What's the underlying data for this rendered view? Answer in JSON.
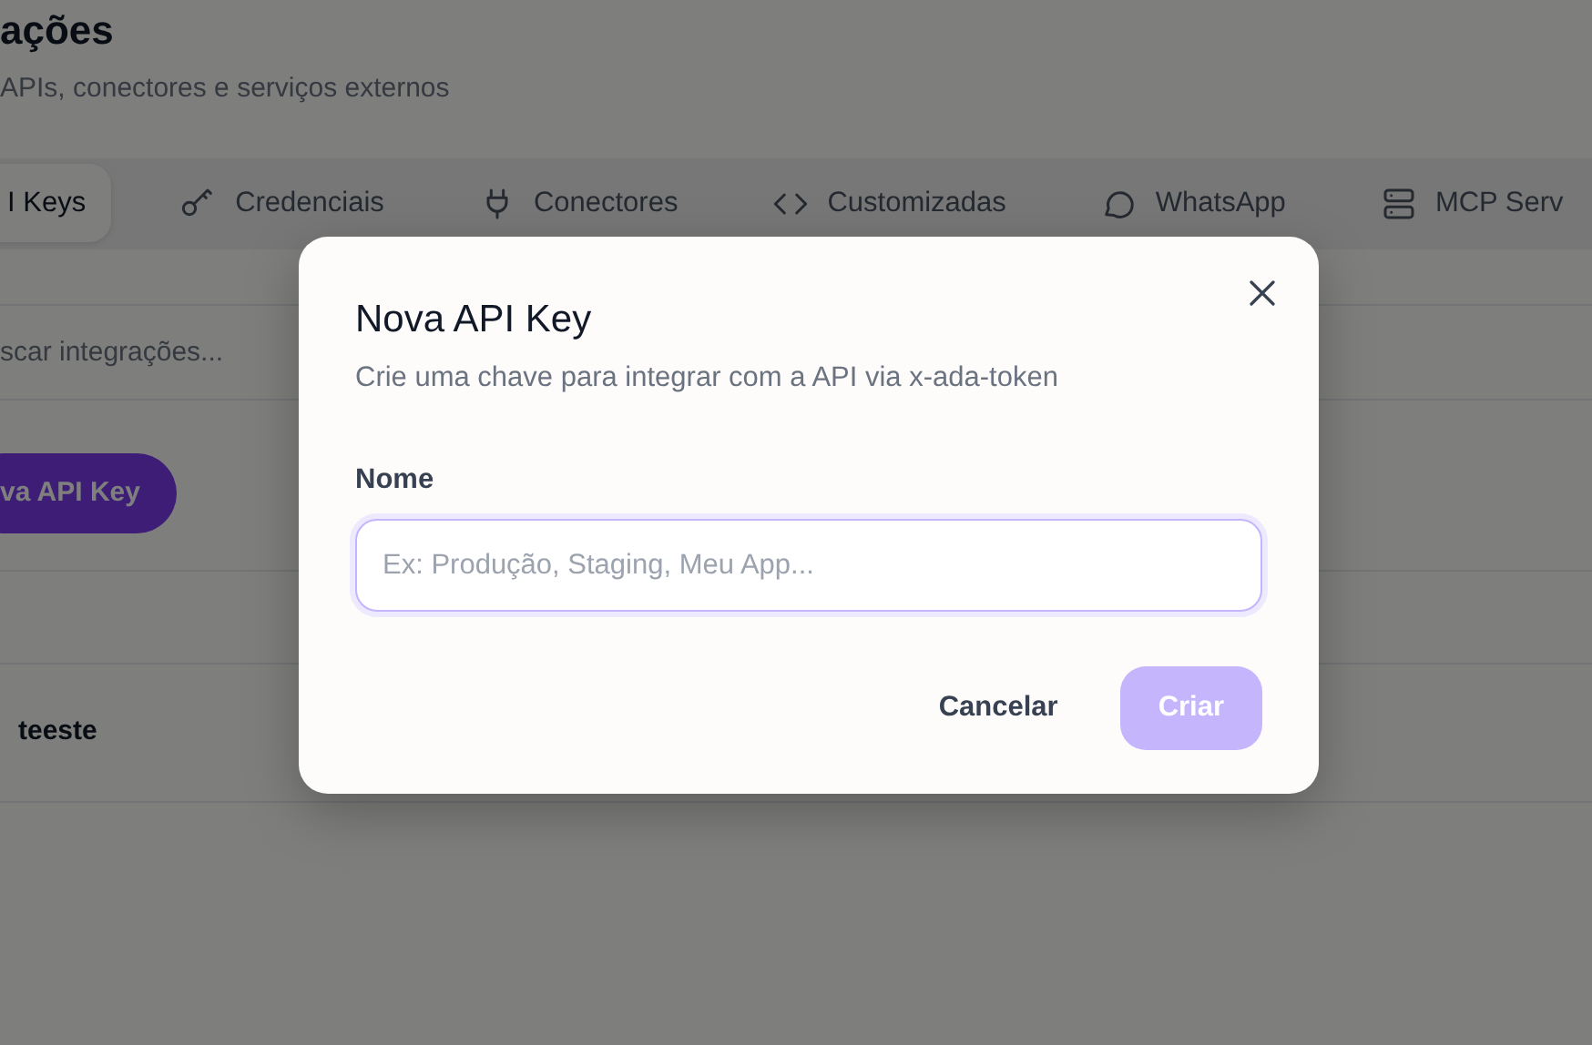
{
  "page": {
    "title": "ações",
    "subtitle": "APIs, conectores e serviços externos"
  },
  "tabs": [
    {
      "label": "I Keys",
      "selected": true
    },
    {
      "label": "Credenciais",
      "selected": false
    },
    {
      "label": "Conectores",
      "selected": false
    },
    {
      "label": "Customizadas",
      "selected": false
    },
    {
      "label": "WhatsApp",
      "selected": false
    },
    {
      "label": "MCP Serv",
      "selected": false
    }
  ],
  "search": {
    "placeholder": "scar integrações..."
  },
  "new_button": "va API Key",
  "rows": [
    {
      "name": "teeste"
    }
  ],
  "modal": {
    "title": "Nova API Key",
    "subtitle": "Crie uma chave para integrar com a API via x-ada-token",
    "field_label": "Nome",
    "placeholder": "Ex: Produção, Staging, Meu App...",
    "cancel": "Cancelar",
    "create": {
      "label": "Criar",
      "disabled": true
    }
  }
}
